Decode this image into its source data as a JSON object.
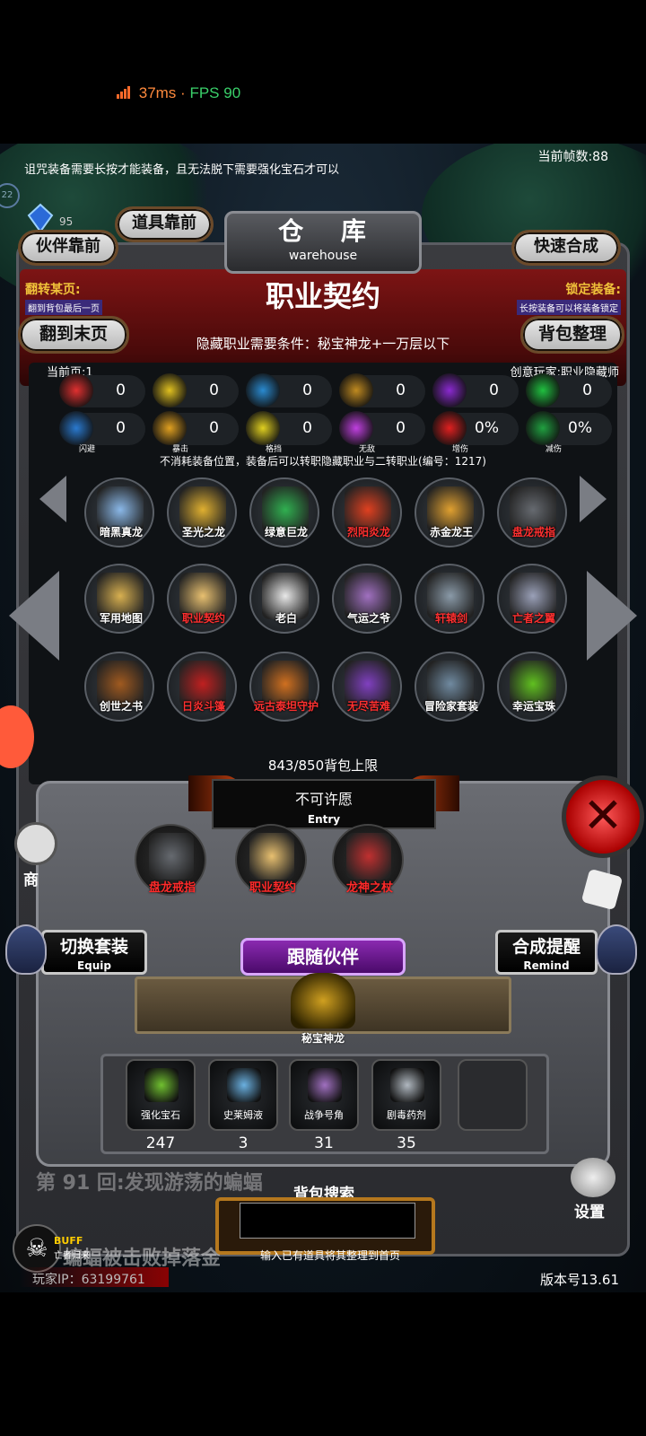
{
  "status": {
    "ping": "37ms",
    "sep": "·",
    "fps": "FPS 90"
  },
  "header": {
    "tip": "诅咒装备需要长按才能装备，且无法脱下需要强化宝石才可以",
    "frame_count": "当前帧数:88",
    "warehouse_cn": "仓 库",
    "warehouse_en": "warehouse",
    "item_front": "道具靠前",
    "partner_front": "伙伴靠前",
    "quick_combine": "快速合成",
    "coin_frag": "95",
    "side_num": "22"
  },
  "banner": {
    "flip_label": "翻转某页:",
    "flip_sub": "翻到背包最后一页",
    "lock_label": "锁定装备:",
    "lock_sub": "长按装备可以将装备锁定",
    "title": "职业契约",
    "requirement": "隐藏职业需要条件：秘宝神龙+一万层以下",
    "to_last_page": "翻到末页",
    "sort_bag": "背包整理",
    "current_page": "当前页:1",
    "creator": "创意玩家:职业隐藏师"
  },
  "stats": [
    {
      "icon": "heart-icon",
      "value": "0",
      "label": "",
      "color": "#e03030"
    },
    {
      "icon": "muscle-icon",
      "value": "0",
      "label": "",
      "color": "#e0c020"
    },
    {
      "icon": "boot-icon",
      "value": "0",
      "label": "",
      "color": "#2a8ad0"
    },
    {
      "icon": "sword-icon",
      "value": "0",
      "label": "",
      "color": "#c08a20"
    },
    {
      "icon": "lightning-icon",
      "value": "0",
      "label": "",
      "color": "#8a2ad0"
    },
    {
      "icon": "clover-icon",
      "value": "0",
      "label": "",
      "color": "#20c040"
    },
    {
      "icon": "dodge-icon",
      "value": "0",
      "label": "闪避",
      "color": "#2a7ad0"
    },
    {
      "icon": "crit-icon",
      "value": "0",
      "label": "暴击",
      "color": "#e0a020"
    },
    {
      "icon": "shield-icon",
      "value": "0",
      "label": "格挡",
      "color": "#e0d020"
    },
    {
      "icon": "invincible-icon",
      "value": "0",
      "label": "无敌",
      "color": "#c040e0"
    },
    {
      "icon": "dmg-up-icon",
      "value": "0%",
      "label": "增伤",
      "color": "#e02020"
    },
    {
      "icon": "dmg-down-icon",
      "value": "0%",
      "label": "减伤",
      "color": "#20a040"
    }
  ],
  "note": "不消耗装备位置，装备后可以转职隐藏职业与二转职业(编号：1217)",
  "inventory": [
    {
      "name": "暗黑真龙",
      "color": "#ffffff",
      "art": "#8ab8e8"
    },
    {
      "name": "圣光之龙",
      "color": "#ffffff",
      "art": "#e0b030"
    },
    {
      "name": "绿意巨龙",
      "color": "#ffffff",
      "art": "#30b050"
    },
    {
      "name": "烈阳炎龙",
      "color": "#ff3030",
      "art": "#e04020"
    },
    {
      "name": "赤金龙王",
      "color": "#ffffff",
      "art": "#e0a030"
    },
    {
      "name": "盘龙戒指",
      "color": "#ff3030",
      "art": "#666a70"
    },
    {
      "name": "军用地图",
      "color": "#ffffff",
      "art": "#d8b050"
    },
    {
      "name": "职业契约",
      "color": "#ff3030",
      "art": "#e8c070"
    },
    {
      "name": "老白",
      "color": "#ffffff",
      "art": "#e8e8e8"
    },
    {
      "name": "气运之爷",
      "color": "#ffffff",
      "art": "#a070c0"
    },
    {
      "name": "轩辕剑",
      "color": "#ff3030",
      "art": "#8a9aa8"
    },
    {
      "name": "亡者之翼",
      "color": "#ff3030",
      "art": "#9aa0b8"
    },
    {
      "name": "创世之书",
      "color": "#ffffff",
      "art": "#a05a20"
    },
    {
      "name": "日炎斗篷",
      "color": "#ff3030",
      "art": "#c02020"
    },
    {
      "name": "远古泰坦守护",
      "color": "#ff3030",
      "art": "#d07020"
    },
    {
      "name": "无尽苦难",
      "color": "#ff3030",
      "art": "#8040c0"
    },
    {
      "name": "冒险家套装",
      "color": "#ffffff",
      "art": "#708aa0"
    },
    {
      "name": "幸运宝珠",
      "color": "#ffffff",
      "art": "#60c020"
    }
  ],
  "capacity": "843/850背包上限",
  "entry": {
    "cn": "不可许愿",
    "en": "Entry"
  },
  "equipped": [
    {
      "name": "盘龙戒指",
      "art": "#666a70"
    },
    {
      "name": "职业契约",
      "art": "#e8c070"
    },
    {
      "name": "龙神之杖",
      "art": "#c03030"
    }
  ],
  "buttons": {
    "switch_cn": "切换套装",
    "switch_en": "Equip",
    "remind_cn": "合成提醒",
    "remind_en": "Remind",
    "follow": "跟随伙伴",
    "shop": "商",
    "settings": "设置"
  },
  "partner": {
    "name": "秘宝神龙",
    "art": "#d0a020"
  },
  "materials": [
    {
      "name": "强化宝石",
      "count": "247",
      "art": "#70c030"
    },
    {
      "name": "史莱姆液",
      "count": "3",
      "art": "#6ab0e0"
    },
    {
      "name": "战争号角",
      "count": "31",
      "art": "#a070c0"
    },
    {
      "name": "剧毒药剂",
      "count": "35",
      "art": "#b0b8c0"
    }
  ],
  "search": {
    "title": "背包搜索",
    "value": "",
    "hint": "输入已有道具将其整理到首页"
  },
  "chat": {
    "line1": "第 91 回:发现游荡的蝙蝠",
    "line2": "蝙蝠被击败掉落金"
  },
  "buff": {
    "label": "BUFF",
    "sub": "亡者归来"
  },
  "footer": {
    "ip": "玩家IP：63199761",
    "version": "版本号13.61"
  }
}
